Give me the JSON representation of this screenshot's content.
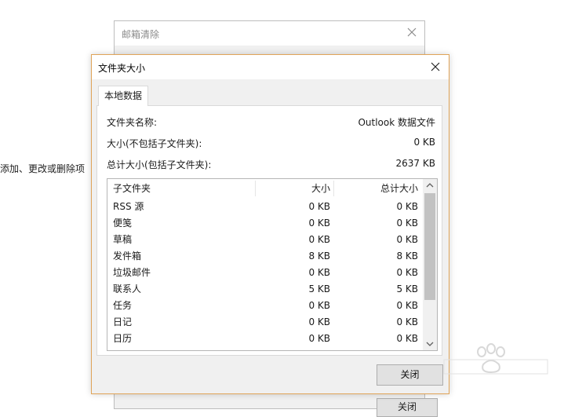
{
  "background": {
    "side_text": "添加、更改或删除项",
    "dialog_title": "邮箱清除",
    "bottom_button": "关闭"
  },
  "dialog": {
    "title": "文件夹大小",
    "tab": "本地数据",
    "folder_name_label": "文件夹名称:",
    "folder_name_value": "Outlook 数据文件",
    "size_label": "大小(不包括子文件夹):",
    "size_value": "0 KB",
    "total_label": "总计大小(包括子文件夹):",
    "total_value": "2637 KB",
    "columns": [
      "子文件夹",
      "大小",
      "总计大小"
    ],
    "rows": [
      {
        "name": "RSS 源",
        "size": "0 KB",
        "total": "0 KB"
      },
      {
        "name": "便笺",
        "size": "0 KB",
        "total": "0 KB"
      },
      {
        "name": "草稿",
        "size": "0 KB",
        "total": "0 KB"
      },
      {
        "name": "发件箱",
        "size": "8 KB",
        "total": "8 KB"
      },
      {
        "name": "垃圾邮件",
        "size": "0 KB",
        "total": "0 KB"
      },
      {
        "name": "联系人",
        "size": "5 KB",
        "total": "5 KB"
      },
      {
        "name": "任务",
        "size": "0 KB",
        "total": "0 KB"
      },
      {
        "name": "日记",
        "size": "0 KB",
        "total": "0 KB"
      },
      {
        "name": "日历",
        "size": "0 KB",
        "total": "0 KB"
      }
    ],
    "close_button": "关闭"
  },
  "icons": {
    "close": "close-icon",
    "scroll_up": "chevron-up-icon",
    "scroll_down": "chevron-down-icon"
  },
  "colors": {
    "dialog_border": "#e0a458",
    "dialog_bg": "#f0f0f0",
    "button_bg": "#e1e1e1",
    "scroll_thumb": "#c2c2c2"
  }
}
